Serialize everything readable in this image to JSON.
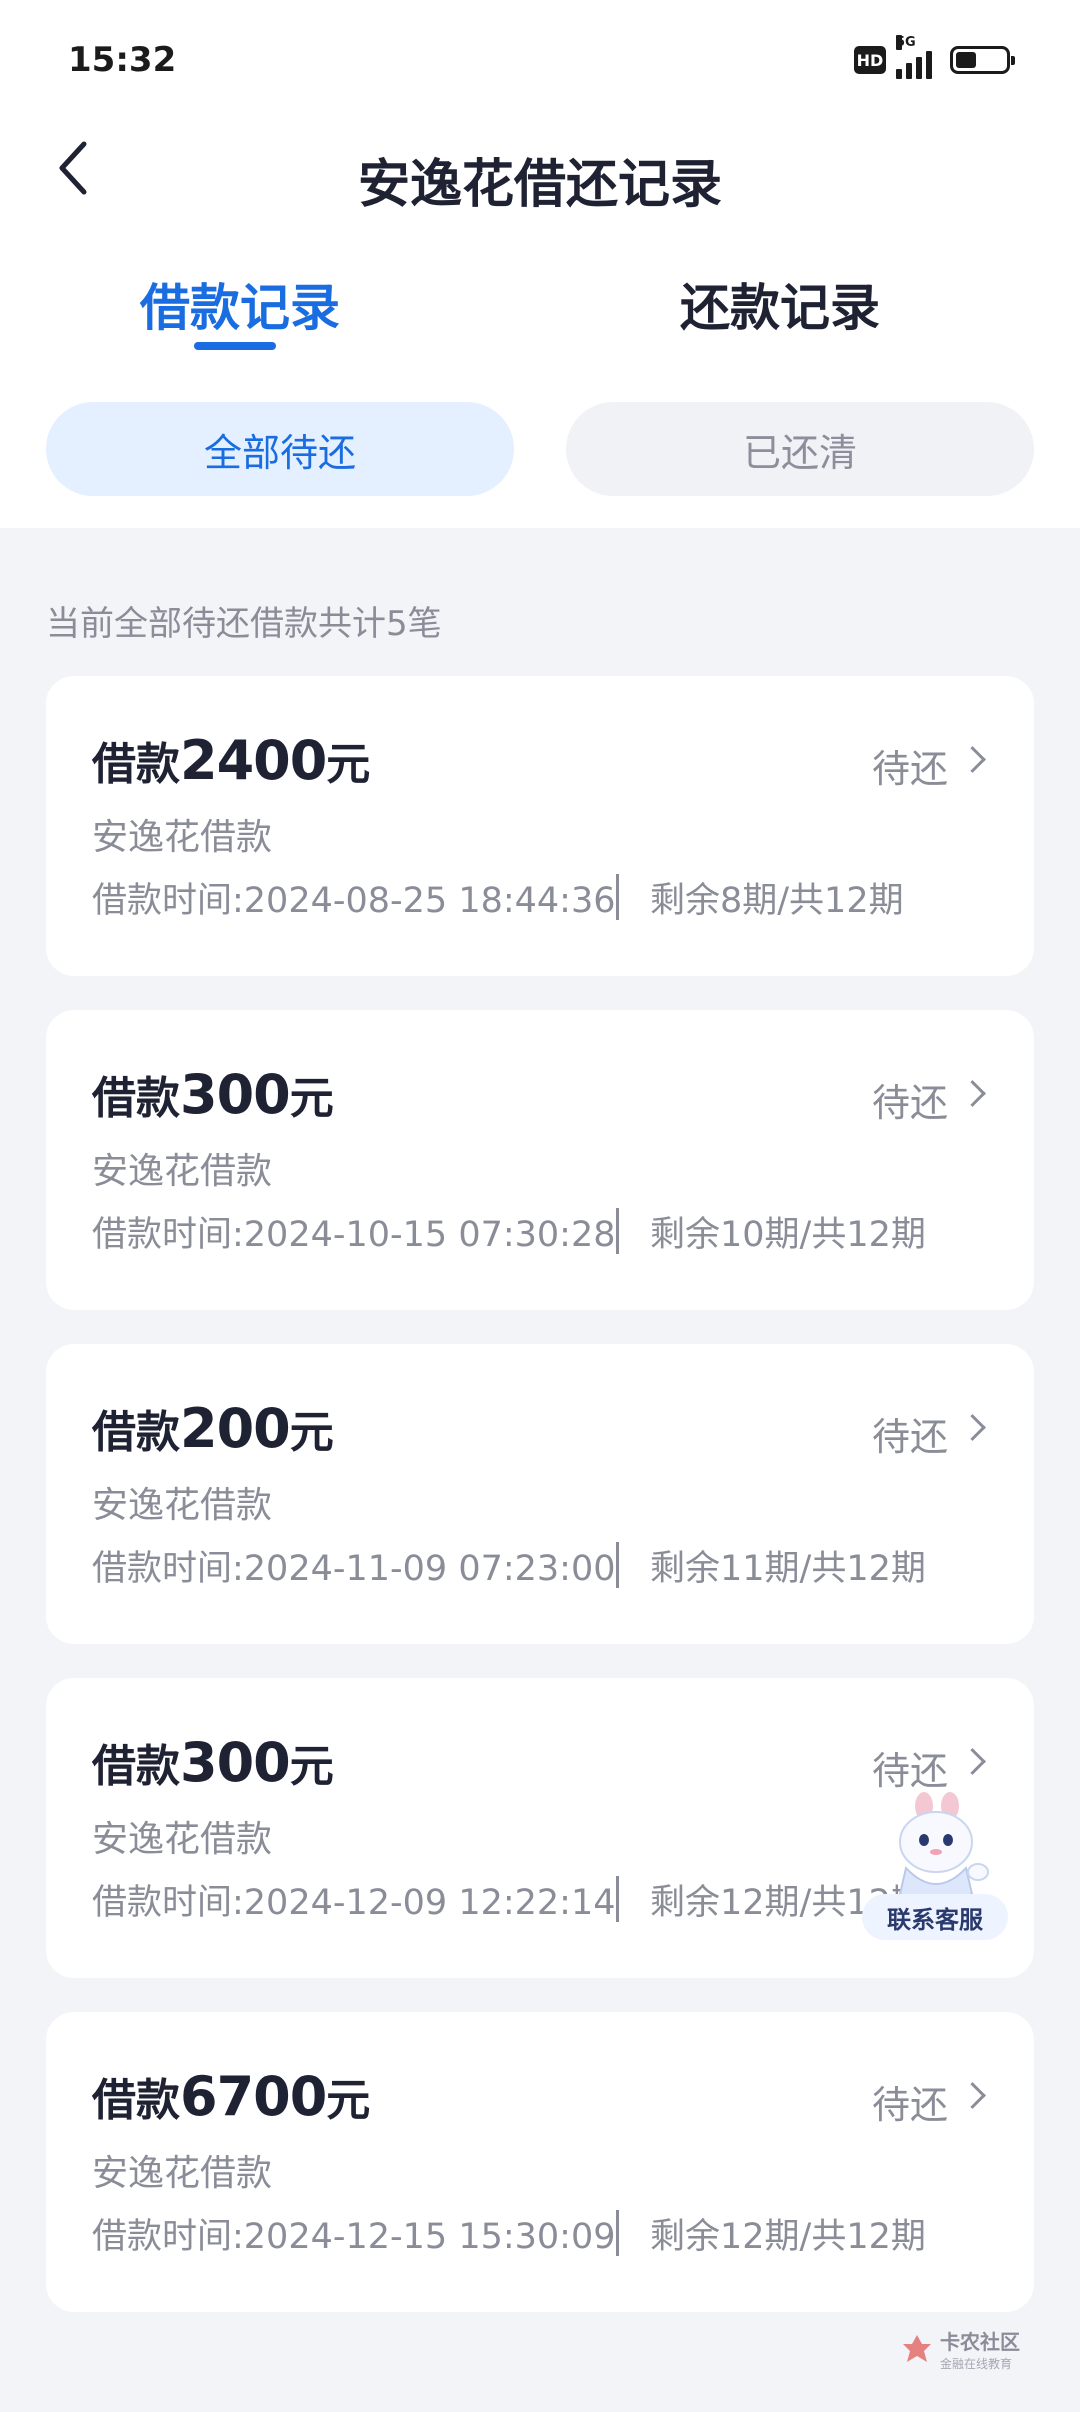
{
  "status_bar": {
    "time": "15:32",
    "hd": "HD",
    "network": "5G"
  },
  "header": {
    "title": "安逸花借还记录"
  },
  "tabs": [
    {
      "label": "借款记录",
      "active": true
    },
    {
      "label": "还款记录",
      "active": false
    }
  ],
  "filters": [
    {
      "label": "全部待还",
      "active": true
    },
    {
      "label": "已还清",
      "active": false
    }
  ],
  "summary": "当前全部待还借款共计5笔",
  "loans": [
    {
      "prefix": "借款",
      "amount": "2400",
      "suffix": "元",
      "status": "待还",
      "name": "安逸花借款",
      "time": "借款时间:2024-08-25 18:44:36",
      "periods": "剩余8期/共12期"
    },
    {
      "prefix": "借款",
      "amount": "300",
      "suffix": "元",
      "status": "待还",
      "name": "安逸花借款",
      "time": "借款时间:2024-10-15 07:30:28",
      "periods": "剩余10期/共12期"
    },
    {
      "prefix": "借款",
      "amount": "200",
      "suffix": "元",
      "status": "待还",
      "name": "安逸花借款",
      "time": "借款时间:2024-11-09 07:23:00",
      "periods": "剩余11期/共12期"
    },
    {
      "prefix": "借款",
      "amount": "300",
      "suffix": "元",
      "status": "待还",
      "name": "安逸花借款",
      "time": "借款时间:2024-12-09 12:22:14",
      "periods": "剩余12期/共12期"
    },
    {
      "prefix": "借款",
      "amount": "6700",
      "suffix": "元",
      "status": "待还",
      "name": "安逸花借款",
      "time": "借款时间:2024-12-15 15:30:09",
      "periods": "剩余12期/共12期"
    }
  ],
  "customer_service": {
    "label": "联系客服"
  },
  "watermark": {
    "text": "卡农社区",
    "sub": "金融在线教育"
  },
  "colors": {
    "accent": "#1a6de0",
    "text": "#1e2233",
    "muted": "#8a8d98",
    "background": "#f3f4f8"
  }
}
